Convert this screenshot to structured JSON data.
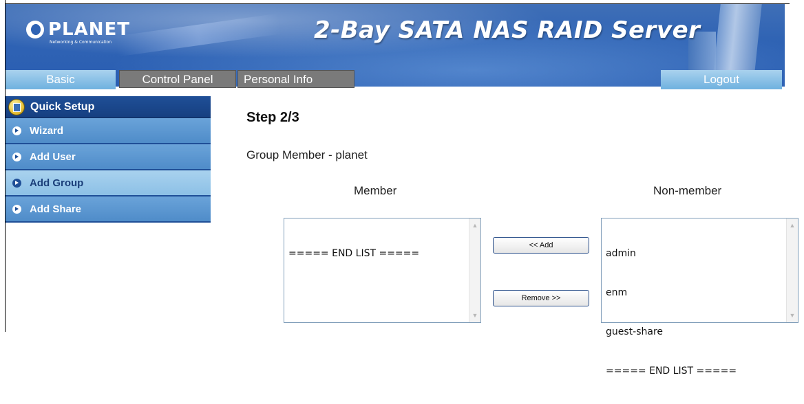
{
  "header": {
    "logo_text": "PLANET",
    "logo_sub": "Networking & Communication",
    "product_title": "2-Bay SATA NAS RAID Server"
  },
  "tabs": {
    "basic": "Basic",
    "control_panel": "Control Panel",
    "personal_info": "Personal Info",
    "logout": "Logout"
  },
  "sidebar": {
    "header": "Quick Setup",
    "items": [
      {
        "label": "Wizard"
      },
      {
        "label": "Add User"
      },
      {
        "label": "Add Group",
        "active": true
      },
      {
        "label": "Add Share"
      }
    ]
  },
  "main": {
    "step_title": "Step 2/3",
    "group_line": "Group Member - planet",
    "member_label": "Member",
    "nonmember_label": "Non-member",
    "member_items": [
      "===== END LIST ====="
    ],
    "nonmember_items": [
      "admin",
      "enm",
      "guest-share",
      "===== END LIST ====="
    ],
    "add_button": "<< Add",
    "remove_button": "Remove >>"
  },
  "colors": {
    "banner_blue": "#2f63b4",
    "sidebar_dark": "#1f4f97",
    "sidebar_item": "#5a94cf",
    "tab_light": "#8cc0e6",
    "tab_gray": "#7a7a7a"
  }
}
